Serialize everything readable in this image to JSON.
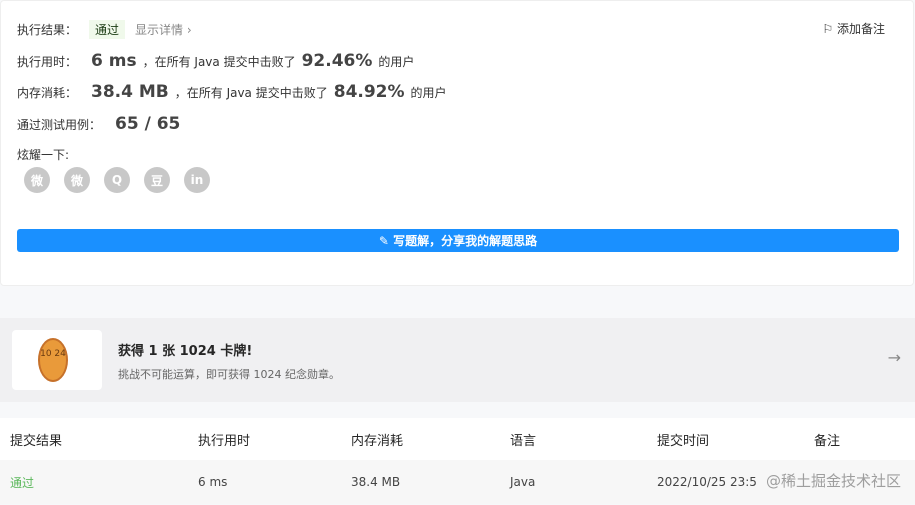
{
  "result": {
    "label": "执行结果：",
    "status": "通过",
    "details": "显示详情 ›",
    "add_note": "添加备注"
  },
  "runtime": {
    "label": "执行用时：",
    "value": "6 ms",
    "middle": "，在所有 Java 提交中击败了",
    "percent": "92.46%",
    "suffix": "的用户"
  },
  "memory": {
    "label": "内存消耗：",
    "value": "38.4 MB",
    "middle": "，在所有 Java 提交中击败了",
    "percent": "84.92%",
    "suffix": "的用户"
  },
  "tests": {
    "label": "通过测试用例：",
    "value": "65 / 65"
  },
  "share": {
    "label": "炫耀一下:",
    "icons": [
      "wechat-icon",
      "weibo-icon",
      "qq-icon",
      "douban-icon",
      "linkedin-icon"
    ],
    "glyphs": [
      "微",
      "微",
      "Q",
      "豆",
      "in"
    ]
  },
  "write_button": "✎ 写题解，分享我的解题思路",
  "banner": {
    "coin_text": "10 24",
    "title": "获得 1 张 1024 卡牌!",
    "subtitle": "挑战不可能运算，即可获得 1024 纪念勋章。"
  },
  "table": {
    "headers": [
      "提交结果",
      "执行用时",
      "内存消耗",
      "语言",
      "提交时间",
      "备注"
    ],
    "rows": [
      [
        "通过",
        "6 ms",
        "38.4 MB",
        "Java",
        "2022/10/25 23:5",
        ""
      ]
    ]
  },
  "watermark": "@稀土掘金技术社区"
}
